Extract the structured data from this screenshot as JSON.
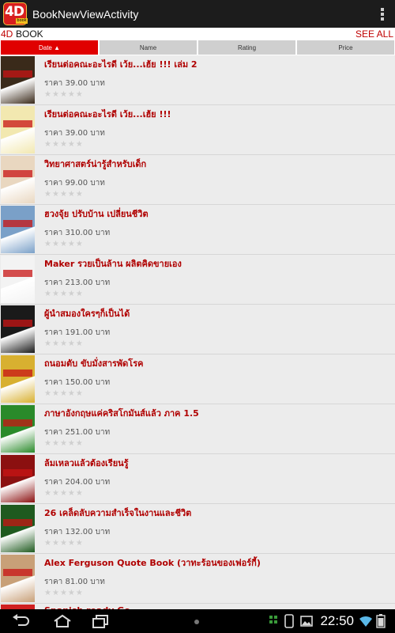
{
  "app": {
    "logo_text": "4D",
    "logo_sub": "book",
    "title": "BookNewViewActivity"
  },
  "section": {
    "prefix": "4D",
    "title": "BOOK",
    "see_all": "SEE ALL"
  },
  "sort_tabs": [
    {
      "label": "Date ▲",
      "active": true
    },
    {
      "label": "Name",
      "active": false
    },
    {
      "label": "Rating",
      "active": false
    },
    {
      "label": "Price",
      "active": false
    }
  ],
  "books": [
    {
      "title": "เรียนต่อคณะอะไรดี เว้ย...เฮ้ย !!! เล่ม 2",
      "price": "ราคา 39.00 บาท",
      "rating": 0
    },
    {
      "title": "เรียนต่อคณะอะไรดี เว้ย...เฮ้ย !!!",
      "price": "ราคา 39.00 บาท",
      "rating": 0
    },
    {
      "title": "วิทยาศาสตร์น่ารู้สำหรับเด็ก",
      "price": "ราคา 99.00 บาท",
      "rating": 0
    },
    {
      "title": "ฮวงจุ้ย ปรับบ้าน เปลี่ยนชีวิต",
      "price": "ราคา 310.00 บาท",
      "rating": 0
    },
    {
      "title": "Maker รวยเป็นล้าน ผลิตคิดขายเอง",
      "price": "ราคา 213.00 บาท",
      "rating": 0
    },
    {
      "title": "ผู้นำสมองใครๆก็เป็นได้",
      "price": "ราคา 191.00 บาท",
      "rating": 0
    },
    {
      "title": "ถนอมตับ ขับมั่งสารพัดโรค",
      "price": "ราคา 150.00 บาท",
      "rating": 0
    },
    {
      "title": "ภาษาอังกฤษแค่คริสโกมันส์แล้ว ภาค 1.5",
      "price": "ราคา 251.00 บาท",
      "rating": 0
    },
    {
      "title": "ล้มเหลวแล้วต้องเรียนรู้",
      "price": "ราคา 204.00 บาท",
      "rating": 0
    },
    {
      "title": "26 เคล็ดลับความสำเร็จในงานและชีวิต",
      "price": "ราคา 132.00 บาท",
      "rating": 0
    },
    {
      "title": "Alex Ferguson Quote Book (วาทะร้อนของเฟอร์กี้)",
      "price": "ราคา 81.00 บาท",
      "rating": 0
    },
    {
      "title": "Spanish ready Go",
      "price": "",
      "rating": 0
    }
  ],
  "cover_colors": [
    "#3a2a1a",
    "#f2e8b0",
    "#e9d7c0",
    "#7aa0c8",
    "#f3f3f3",
    "#1a1a1a",
    "#d8b030",
    "#2a8a2a",
    "#8b1010",
    "#1f5a1f",
    "#c8a078",
    "#d02020"
  ],
  "status": {
    "time": "22:50"
  }
}
